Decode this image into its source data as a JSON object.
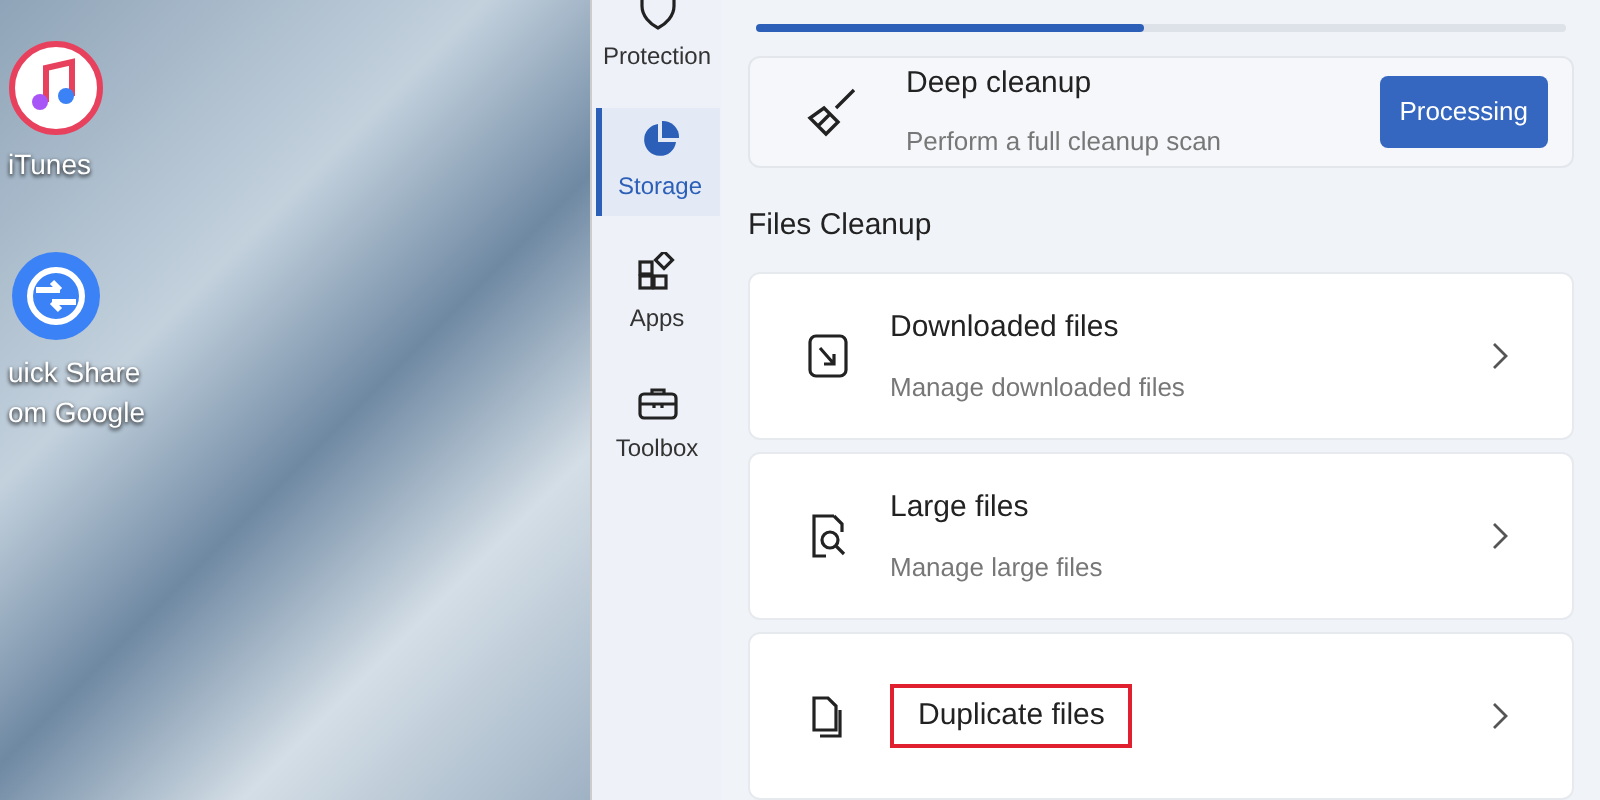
{
  "desktop": {
    "icons": [
      {
        "kind": "music",
        "label": "iTunes"
      },
      {
        "kind": "share",
        "label": "uick Share\nom Google"
      }
    ]
  },
  "nav": {
    "items": [
      {
        "kind": "shield",
        "label": "Protection",
        "selected": false
      },
      {
        "kind": "pie",
        "label": "Storage",
        "selected": true
      },
      {
        "kind": "apps",
        "label": "Apps",
        "selected": false
      },
      {
        "kind": "toolbox",
        "label": "Toolbox",
        "selected": false
      }
    ]
  },
  "drive": {
    "level": 0.48
  },
  "deep_cleanup": {
    "title": "Deep cleanup",
    "subtitle": "Perform a full cleanup scan",
    "button": "Processing"
  },
  "files_cleanup": {
    "heading": "Files Cleanup",
    "items": [
      {
        "kind": "download",
        "title": "Downloaded files",
        "subtitle": "Manage downloaded files",
        "highlighted": false
      },
      {
        "kind": "search",
        "title": "Large files",
        "subtitle": "Manage large files",
        "highlighted": false
      },
      {
        "kind": "copy",
        "title": "Duplicate files",
        "highlighted": true
      }
    ]
  }
}
